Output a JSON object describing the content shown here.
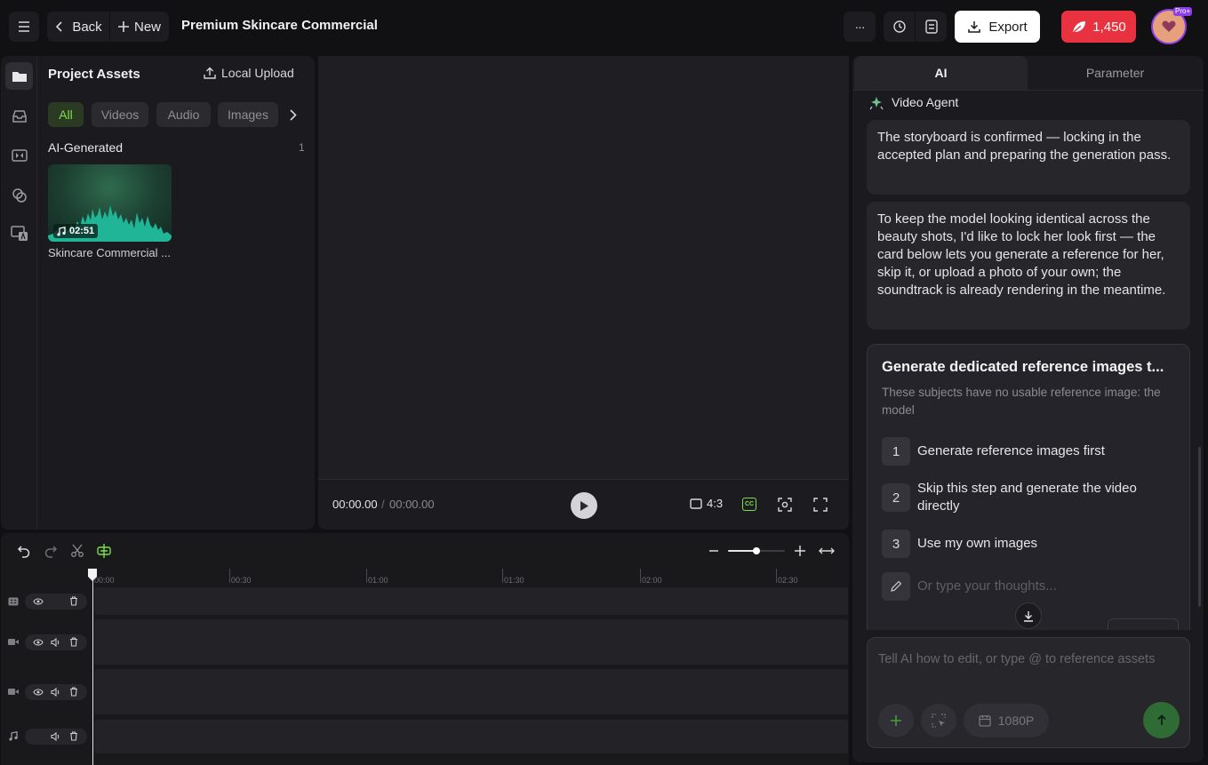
{
  "header": {
    "back_label": "Back",
    "new_label": "New",
    "project_title": "Premium Skincare Commercial",
    "more_label": "···",
    "export_label": "Export",
    "credits": "1,450",
    "plan_badge": "Pro+"
  },
  "assets": {
    "title": "Project Assets",
    "upload_label": "Local Upload",
    "filters": [
      "All",
      "Videos",
      "Audio",
      "Images"
    ],
    "section_title": "AI-Generated",
    "section_count": "1",
    "items": [
      {
        "name": "Skincare Commercial ...",
        "duration": "02:51"
      }
    ]
  },
  "player": {
    "current_time": "00:00.00",
    "separator": "/",
    "total_time": "00:00.00",
    "aspect_ratio": "4:3"
  },
  "timeline": {
    "tick_labels": [
      "00:00",
      "00:30",
      "01:00",
      "01:30",
      "02:00",
      "02:30"
    ]
  },
  "right_panel": {
    "tabs": [
      "AI",
      "Parameter"
    ],
    "agent_name": "Video Agent",
    "messages": [
      "The storyboard is confirmed — locking in the accepted plan and preparing the generation pass.",
      "To keep the model looking identical across the beauty shots, I'd like to lock her look first — the card below lets you generate a reference for her, skip it, or upload a photo of your own; the soundtrack is already rendering in the meantime."
    ],
    "card": {
      "title": "Generate dedicated reference images t...",
      "subtitle": "These subjects have no usable reference image: the model",
      "options": [
        {
          "num": "1",
          "label": "Generate reference images first"
        },
        {
          "num": "2",
          "label": "Skip this step and generate the video directly"
        },
        {
          "num": "3",
          "label": "Use my own images"
        }
      ],
      "custom_placeholder": "Or type your thoughts..."
    },
    "input_placeholder": "Tell AI how to edit, or type @ to reference assets",
    "resolution": "1080P"
  },
  "colors": {
    "accent_green": "#7ddf4a",
    "credits_red": "#e8323f",
    "audio_teal": "#1fb596",
    "send_green": "#2f6b35"
  }
}
